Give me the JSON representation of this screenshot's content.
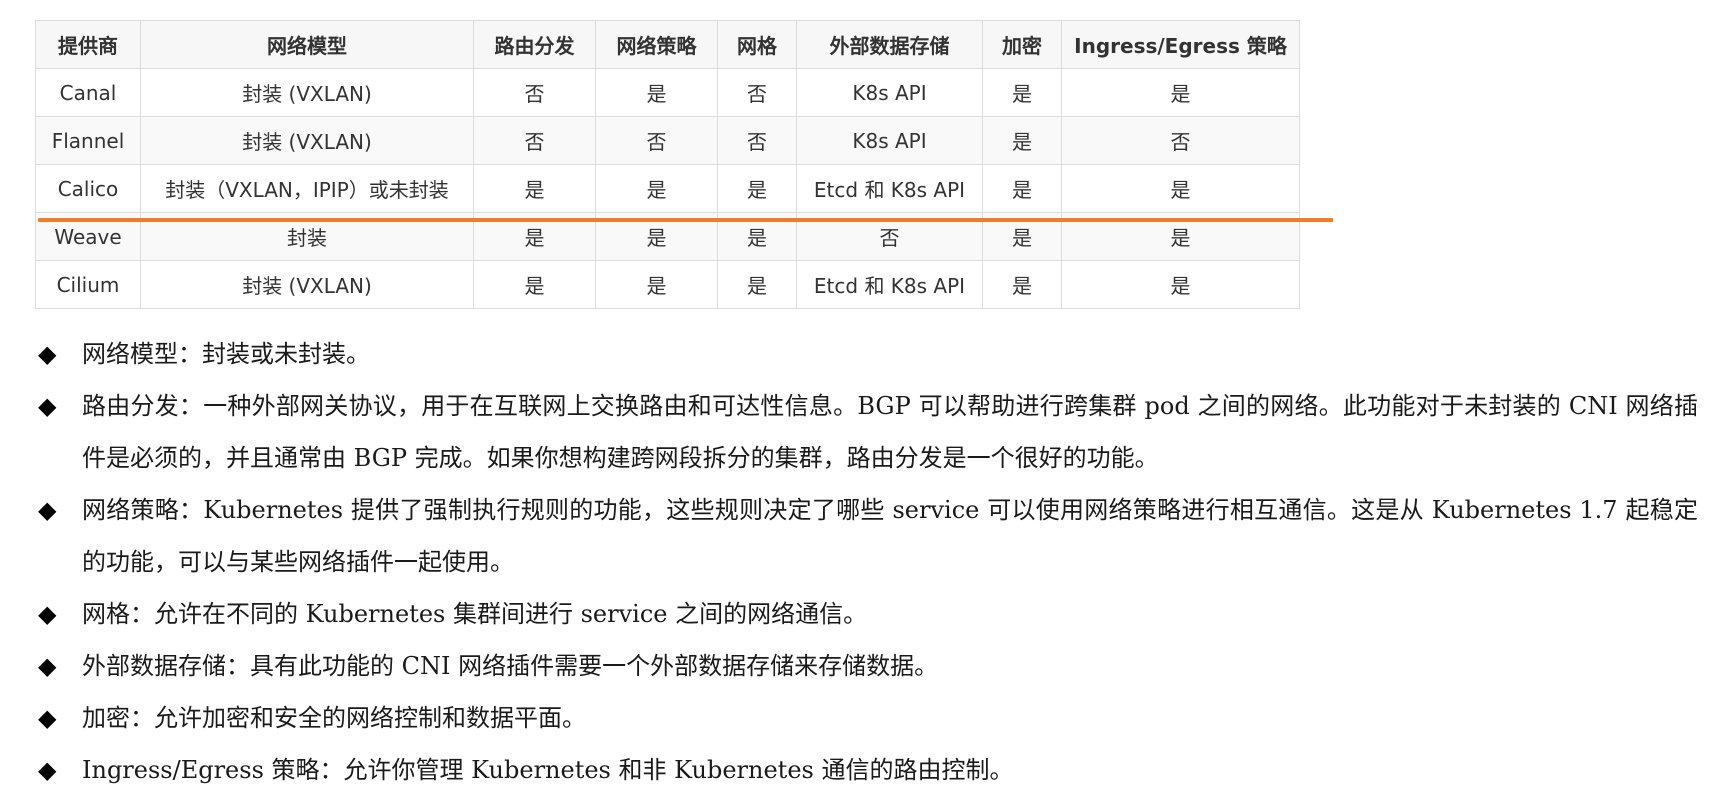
{
  "table": {
    "headers": [
      "提供商",
      "网络模型",
      "路由分发",
      "网络策略",
      "网格",
      "外部数据存储",
      "加密",
      "Ingress/Egress 策略"
    ],
    "rows": [
      [
        "Canal",
        "封装 (VXLAN)",
        "否",
        "是",
        "否",
        "K8s API",
        "是",
        "是"
      ],
      [
        "Flannel",
        "封装 (VXLAN)",
        "否",
        "否",
        "否",
        "K8s API",
        "是",
        "否"
      ],
      [
        "Calico",
        "封装（VXLAN，IPIP）或未封装",
        "是",
        "是",
        "是",
        "Etcd 和 K8s API",
        "是",
        "是"
      ],
      [
        "Weave",
        "封装",
        "是",
        "是",
        "是",
        "否",
        "是",
        "是"
      ],
      [
        "Cilium",
        "封装 (VXLAN)",
        "是",
        "是",
        "是",
        "Etcd 和 K8s API",
        "是",
        "是"
      ]
    ]
  },
  "highlight_color": "#ee7f2a",
  "bullet_icon": "diamond-bullet-icon",
  "bullet_glyph": "◆",
  "notes": [
    "网络模型：封装或未封装。",
    "路由分发：一种外部网关协议，用于在互联网上交换路由和可达性信息。BGP 可以帮助进行跨集群 pod 之间的网络。此功能对于未封装的 CNI 网络插件是必须的，并且通常由 BGP 完成。如果你想构建跨网段拆分的集群，路由分发是一个很好的功能。",
    "网络策略：Kubernetes 提供了强制执行规则的功能，这些规则决定了哪些 service 可以使用网络策略进行相互通信。这是从 Kubernetes 1.7 起稳定的功能，可以与某些网络插件一起使用。",
    "网格：允许在不同的 Kubernetes 集群间进行 service 之间的网络通信。",
    "外部数据存储：具有此功能的 CNI 网络插件需要一个外部数据存储来存储数据。",
    "加密：允许加密和安全的网络控制和数据平面。",
    "Ingress/Egress 策略：允许你管理 Kubernetes 和非 Kubernetes 通信的路由控制。"
  ]
}
